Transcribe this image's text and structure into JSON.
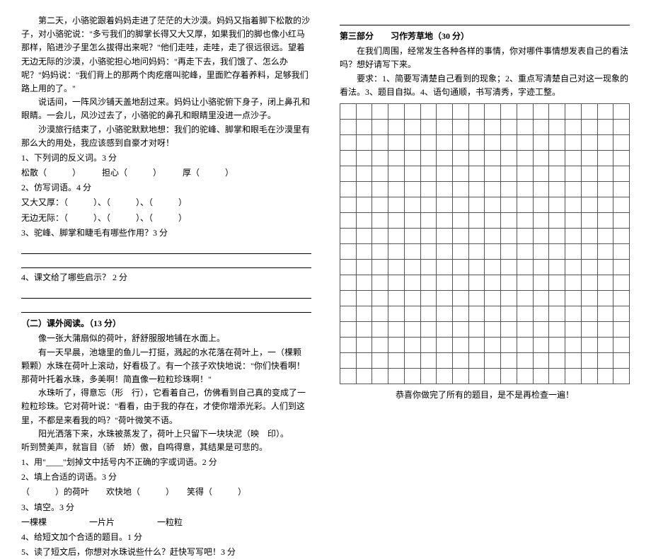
{
  "left": {
    "story_p1": "第二天，小骆驼跟着妈妈走进了茫茫的大沙漠。妈妈又指着脚下松散的沙子，对小骆驼说：\"多亏我们的脚掌长得又大又厚，如果我们的脚也像小红马那样，陷进沙子里怎么拔得出来呢？\"他们走哇，走哇，走了很远很远。望着无边无际的沙漠，小骆驼担心地问妈妈：\"再走下去，我们饿了、怎么办呢？\"妈妈说：\"我们背上的那两个肉疙瘩叫驼峰，里面贮存着养料，足够我们路上用的了。\"",
    "story_p2": "说话间，一阵风沙铺天盖地刮过来。妈妈让小骆驼俯下身子，闭上鼻孔和眼睛。一会儿，风沙过去了，小骆驼的鼻孔和眼睛里没进一点沙子。",
    "story_p3": "沙漠旅行结束了，小骆驼默默地想：我们的驼峰、脚掌和眼毛在沙漠里有那么大的用处，我应该感到自豪才对呀！",
    "q1": "1、下列词的反义词。3 分",
    "q1_line": "松散（　　　）　　　担心（　　　）　　　厚（　　　）",
    "q2": "2、仿写词语。4 分",
    "q2_line1": "又大又厚：（　　　）、（　　　）、（　　　）",
    "q2_line2": "无边无际：（　　　）、（　　　）、（　　　）",
    "q3": "3、驼峰、脚掌和睫毛有哪些作用？3 分",
    "q4": "4、课文给了哪些启示？ 2 分",
    "section2": "（二）课外阅读。（13 分）",
    "r_p1": "像一张大蒲扇似的荷叶，舒舒服服地铺在水面上。",
    "r_p2": "有一天早晨，池塘里的鱼儿一打挺，溅起的水花落在荷叶上，一（棵颗　颗颗）水珠在荷叶上滚动，好看极了。有一个孩子欢快地说：\"你们快看啊！那荷叶托着水珠，多美啊！简直像一粒粒珍珠啊！\"",
    "r_p3": "水珠听了，得意忘（形　行），它看着自己，仿佛看到自己真的变成了一粒粒珍珠。它对荷叶说：\"看看，由于我的存在，才使你增添光彩。人们到这里，不都是来看我的吗？\"荷叶微笑不语。",
    "r_p4": "阳光洒落下来，水珠被蒸发了，荷叶上只留下一块块泥（映　印）。",
    "r_p5": "听到赞美声，就盲目（骄　娇）傲，自鸣得意，其结果是可悲的。",
    "rq1": "1、用\"____\"划掉文中括号内不正确的字或词语。2 分",
    "rq2": "2、填上合适的词语。3 分",
    "rq2_line": "（　　　）的荷叶　　欢快地（　　　）　　笑得（　　　）",
    "rq3": "3、填空。3 分",
    "rq3_line": "一棵棵　　　　　一片片　　　　　一粒粒",
    "rq4": "4、给短文加个合适的题目。1 分",
    "rq5": "5、读了短文后，你想对水珠说些什么？赶快写写吧！3 分"
  },
  "right": {
    "part3_title": "第三部分　　习作芳草地（30 分）",
    "part3_intro": "在我们周围，经常发生各种各样的事情，你对哪件事情想发表自己的看法吗？想好请写下来。",
    "part3_req": "要求：1、简要写清楚自己看到的现象；2、重点写清楚自己对这一现象的看法。3、题目自拟。4、语句通顺，书写清秀，字迹工整。",
    "footer": "恭喜你做完了所有的题目，是不是再检查一遍！"
  },
  "grid": {
    "rows": 18,
    "cols": 18
  }
}
